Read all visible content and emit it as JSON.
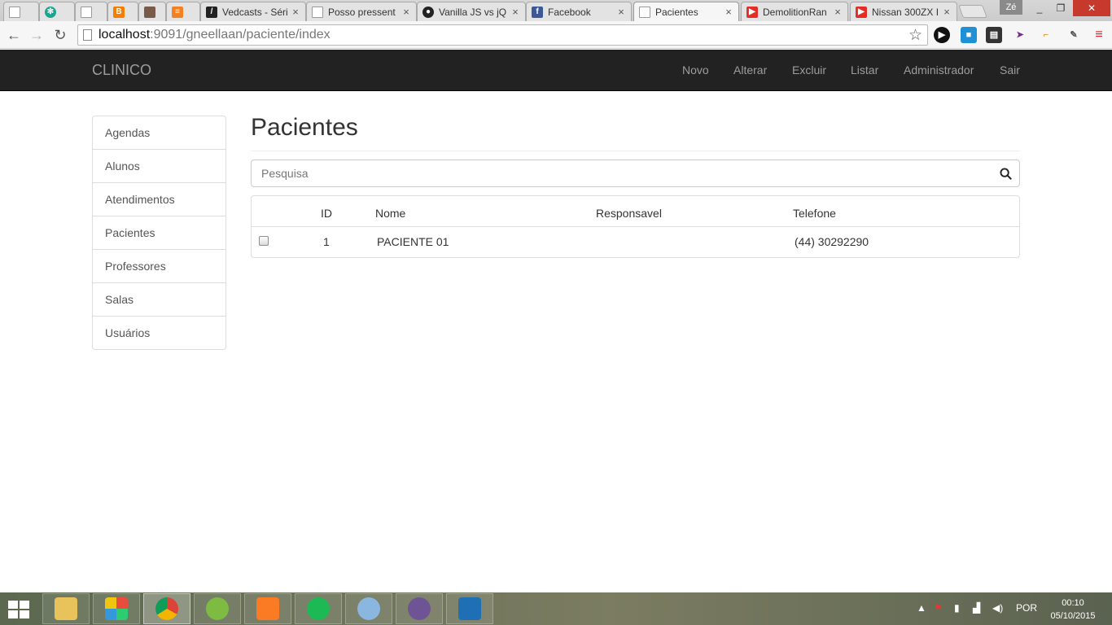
{
  "browser": {
    "tabs": [
      {
        "title": "",
        "favicon": "page-icon"
      },
      {
        "title": "",
        "favicon": "snowflake-icon"
      },
      {
        "title": "",
        "favicon": "page-icon"
      },
      {
        "title": "",
        "favicon": "blogger-icon"
      },
      {
        "title": "",
        "favicon": "avatar-photo-icon"
      },
      {
        "title": "",
        "favicon": "stackoverflow-icon"
      },
      {
        "title": "Vedcasts - Séri",
        "favicon": "vedcasts-icon"
      },
      {
        "title": "Posso pressent",
        "favicon": "page-icon"
      },
      {
        "title": "Vanilla JS vs jQ",
        "favicon": "github-icon"
      },
      {
        "title": "Facebook",
        "favicon": "facebook-icon"
      },
      {
        "title": "Pacientes",
        "favicon": "page-icon",
        "active": true
      },
      {
        "title": "DemolitionRan",
        "favicon": "youtube-icon"
      },
      {
        "title": "Nissan 300ZX I",
        "favicon": "youtube-icon"
      }
    ],
    "profile_name": "Zé",
    "url_host": "localhost",
    "url_rest": ":9091/gneellaan/paciente/index"
  },
  "app": {
    "brand": "CLINICO",
    "nav": [
      "Novo",
      "Alterar",
      "Excluir",
      "Listar",
      "Administrador",
      "Sair"
    ],
    "sidebar": [
      "Agendas",
      "Alunos",
      "Atendimentos",
      "Pacientes",
      "Professores",
      "Salas",
      "Usuários"
    ],
    "page_title": "Pacientes",
    "search_placeholder": "Pesquisa",
    "table": {
      "headers": [
        "ID",
        "Nome",
        "Responsavel",
        "Telefone"
      ],
      "rows": [
        {
          "id": "1",
          "nome": "PACIENTE 01",
          "responsavel": "",
          "telefone": "(44) 30292290"
        }
      ]
    }
  },
  "taskbar": {
    "language": "POR",
    "time": "00:10",
    "date": "05/10/2015"
  },
  "colors": {
    "navbar_bg": "#222222",
    "navbar_text": "#9d9d9d",
    "border": "#dddddd"
  }
}
